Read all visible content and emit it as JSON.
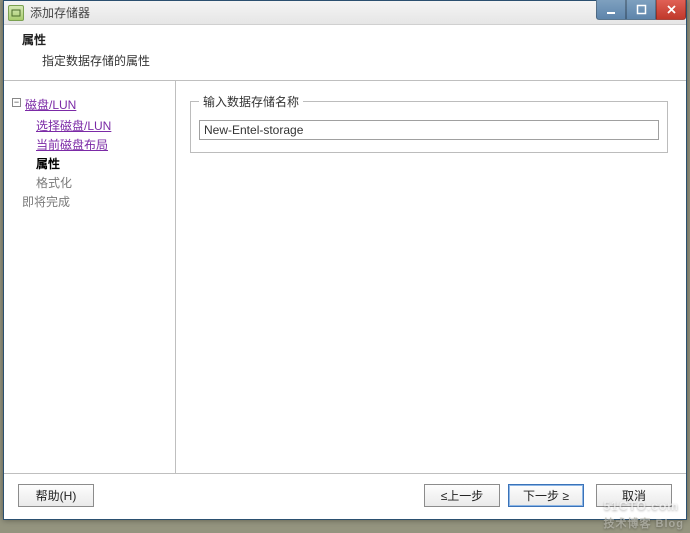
{
  "window": {
    "title": "添加存储器"
  },
  "header": {
    "title": "属性",
    "desc": "指定数据存储的属性"
  },
  "nav": {
    "root": "磁盘/LUN",
    "items": [
      {
        "label": "选择磁盘/LUN",
        "type": "link"
      },
      {
        "label": "当前磁盘布局",
        "type": "link"
      },
      {
        "label": "属性",
        "type": "current"
      },
      {
        "label": "格式化",
        "type": "disabled"
      }
    ],
    "last": "即将完成"
  },
  "content": {
    "fieldset_legend": "输入数据存储名称",
    "name_value": "New-Entel-storage"
  },
  "footer": {
    "help": "帮助(H)",
    "back": "≤上一步",
    "next": "下一步 ≥",
    "cancel": "取消"
  },
  "watermark": {
    "line1": "51CTO.com",
    "line2": "技术博客 Blog"
  }
}
